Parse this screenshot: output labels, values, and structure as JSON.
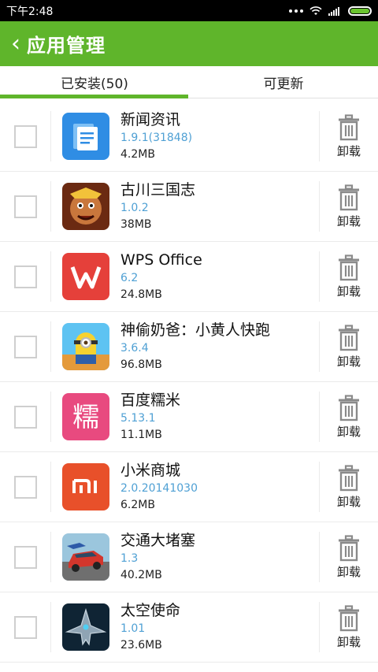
{
  "status": {
    "time": "下午2:48"
  },
  "header": {
    "back_glyph": "‹",
    "title": "应用管理"
  },
  "tabs": [
    {
      "label": "已安装(50)",
      "active": true
    },
    {
      "label": "可更新",
      "active": false
    }
  ],
  "uninstall_label": "卸载",
  "apps": [
    {
      "name": "新闻资讯",
      "version": "1.9.1(31848)",
      "size": "4.2MB",
      "icon": "news-icon",
      "color": "#2f8de4"
    },
    {
      "name": "古川三国志",
      "version": "1.0.2",
      "size": "38MB",
      "icon": "game-warrior-icon",
      "color": "#8a3b1a"
    },
    {
      "name": "WPS Office",
      "version": "6.2",
      "size": "24.8MB",
      "icon": "wps-icon",
      "color": "#e5403a"
    },
    {
      "name": "神偷奶爸：小黄人快跑",
      "version": "3.6.4",
      "size": "96.8MB",
      "icon": "minion-icon",
      "color": "#3aa0e0"
    },
    {
      "name": "百度糯米",
      "version": "5.13.1",
      "size": "11.1MB",
      "icon": "nuomi-icon",
      "color": "#e84a7f"
    },
    {
      "name": "小米商城",
      "version": "2.0.20141030",
      "size": "6.2MB",
      "icon": "mi-store-icon",
      "color": "#e8502a"
    },
    {
      "name": "交通大堵塞",
      "version": "1.3",
      "size": "40.2MB",
      "icon": "traffic-car-icon",
      "color": "#c83b2f"
    },
    {
      "name": "太空使命",
      "version": "1.01",
      "size": "23.6MB",
      "icon": "spaceship-icon",
      "color": "#1d3b52"
    }
  ]
}
